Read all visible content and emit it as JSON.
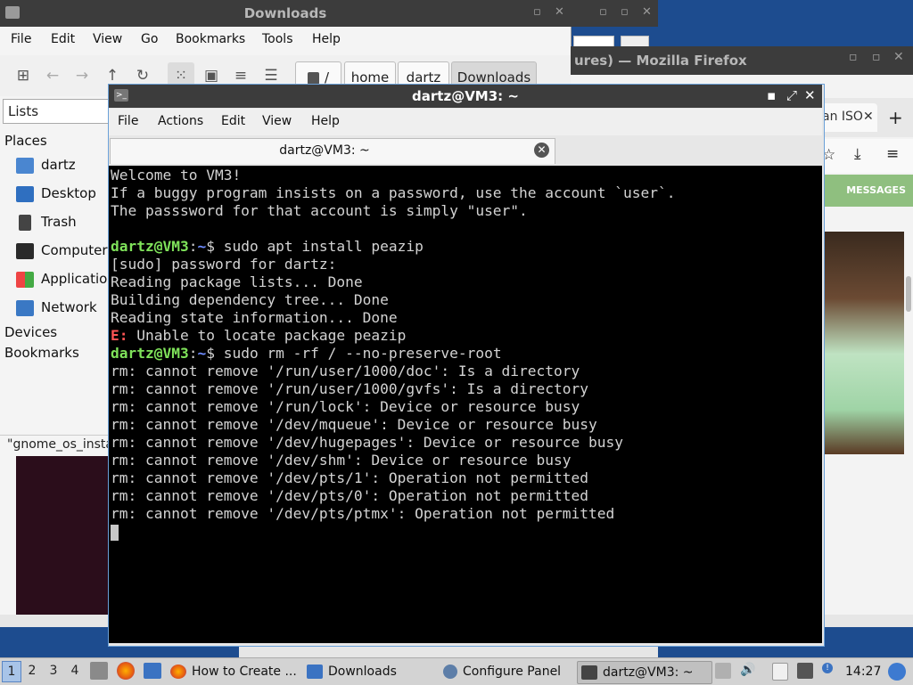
{
  "file_manager": {
    "title": "Downloads",
    "menu": [
      "File",
      "Edit",
      "View",
      "Go",
      "Bookmarks",
      "Tools",
      "Help"
    ],
    "path_root": "/",
    "path": [
      "home",
      "dartz",
      "Downloads"
    ],
    "side_selector": "Lists",
    "places_header": "Places",
    "places": [
      "dartz",
      "Desktop",
      "Trash",
      "Computer",
      "Applications",
      "Network"
    ],
    "devices_header": "Devices",
    "bookmarks_header": "Bookmarks",
    "status": "\"gnome_os_insta"
  },
  "firefox": {
    "title": "ures) — Mozilla Firefox",
    "tab_label": "an ISO",
    "banner_label": "MESSAGES"
  },
  "terminal": {
    "title": "dartz@VM3: ~",
    "menu": [
      "File",
      "Actions",
      "Edit",
      "View",
      "Help"
    ],
    "tab_label": "dartz@VM3: ~",
    "lines": [
      {
        "kind": "text",
        "text": "Welcome to VM3!"
      },
      {
        "kind": "text",
        "text": "If a buggy program insists on a password, use the account `user`."
      },
      {
        "kind": "text",
        "text": "The passsword for that account is simply \"user\"."
      },
      {
        "kind": "text",
        "text": ""
      },
      {
        "kind": "prompt",
        "user": "dartz@VM3",
        "path": "~",
        "cmd": "$ sudo apt install peazip"
      },
      {
        "kind": "text",
        "text": "[sudo] password for dartz:"
      },
      {
        "kind": "text",
        "text": "Reading package lists... Done"
      },
      {
        "kind": "text",
        "text": "Building dependency tree... Done"
      },
      {
        "kind": "text",
        "text": "Reading state information... Done"
      },
      {
        "kind": "error",
        "tag": "E:",
        "text": " Unable to locate package peazip"
      },
      {
        "kind": "prompt",
        "user": "dartz@VM3",
        "path": "~",
        "cmd": "$ sudo rm -rf / --no-preserve-root"
      },
      {
        "kind": "text",
        "text": "rm: cannot remove '/run/user/1000/doc': Is a directory"
      },
      {
        "kind": "text",
        "text": "rm: cannot remove '/run/user/1000/gvfs': Is a directory"
      },
      {
        "kind": "text",
        "text": "rm: cannot remove '/run/lock': Device or resource busy"
      },
      {
        "kind": "text",
        "text": "rm: cannot remove '/dev/mqueue': Device or resource busy"
      },
      {
        "kind": "text",
        "text": "rm: cannot remove '/dev/hugepages': Device or resource busy"
      },
      {
        "kind": "text",
        "text": "rm: cannot remove '/dev/shm': Device or resource busy"
      },
      {
        "kind": "text",
        "text": "rm: cannot remove '/dev/pts/1': Operation not permitted"
      },
      {
        "kind": "text",
        "text": "rm: cannot remove '/dev/pts/0': Operation not permitted"
      },
      {
        "kind": "text",
        "text": "rm: cannot remove '/dev/pts/ptmx': Operation not permitted"
      }
    ]
  },
  "taskbar": {
    "workspaces": [
      "1",
      "2",
      "3",
      "4"
    ],
    "tasks": [
      {
        "label": "How to Create ...",
        "icon": "firefox-icon"
      },
      {
        "label": "Downloads",
        "icon": "folder-icon"
      },
      {
        "label": "Configure Panel",
        "icon": "settings-icon"
      },
      {
        "label": "dartz@VM3: ~",
        "icon": "terminal-icon"
      }
    ],
    "clock": "14:27"
  },
  "colors": {
    "prompt_user": "#7fe25a",
    "prompt_path": "#6f8cff",
    "error_tag": "#ff5555",
    "desktop": "#1d4c8f"
  }
}
